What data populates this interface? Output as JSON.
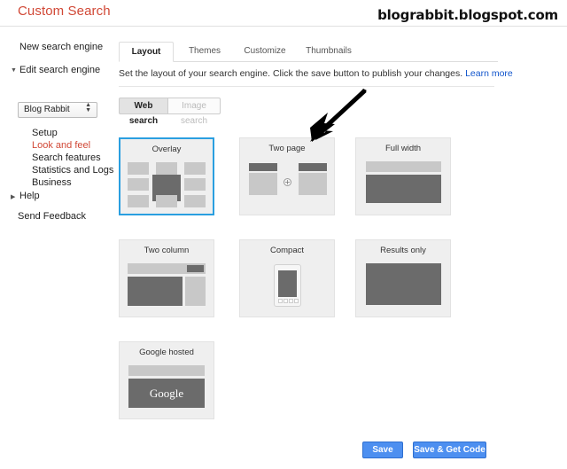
{
  "header": {
    "app_title": "Custom Search",
    "watermark": "blograbbit.blogspot.com"
  },
  "sidebar": {
    "new_engine": "New search engine",
    "edit_engine": "Edit search engine",
    "engine_select_value": "Blog Rabbit",
    "items": [
      {
        "label": "Setup",
        "active": false
      },
      {
        "label": "Look and feel",
        "active": true
      },
      {
        "label": "Search features",
        "active": false
      },
      {
        "label": "Statistics and Logs",
        "active": false
      },
      {
        "label": "Business",
        "active": false
      }
    ],
    "help": "Help",
    "send_feedback": "Send Feedback"
  },
  "main": {
    "tabs": [
      {
        "label": "Layout",
        "active": true
      },
      {
        "label": "Themes",
        "active": false
      },
      {
        "label": "Customize",
        "active": false
      },
      {
        "label": "Thumbnails",
        "active": false
      }
    ],
    "description": "Set the layout of your search engine. Click the save button to publish your changes.",
    "learn_more": "Learn more",
    "search_type": {
      "web": "Web search",
      "image": "Image search"
    },
    "layouts": [
      {
        "label": "Overlay",
        "selected": true
      },
      {
        "label": "Two page",
        "selected": false
      },
      {
        "label": "Full width",
        "selected": false
      },
      {
        "label": "Two column",
        "selected": false
      },
      {
        "label": "Compact",
        "selected": false
      },
      {
        "label": "Results only",
        "selected": false
      },
      {
        "label": "Google hosted",
        "selected": false
      }
    ],
    "google_hosted_wordmark": "Google",
    "two_page_plus": "+"
  },
  "footer": {
    "save": "Save",
    "save_get_code": "Save & Get Code"
  },
  "colors": {
    "brand_red": "#d14836",
    "selected_blue": "#2a9fe0",
    "button_blue": "#4d8ff0",
    "link_blue": "#1155cc",
    "card_bg": "#efefef",
    "block_light": "#c8c8c8",
    "block_dark": "#6b6b6b"
  }
}
